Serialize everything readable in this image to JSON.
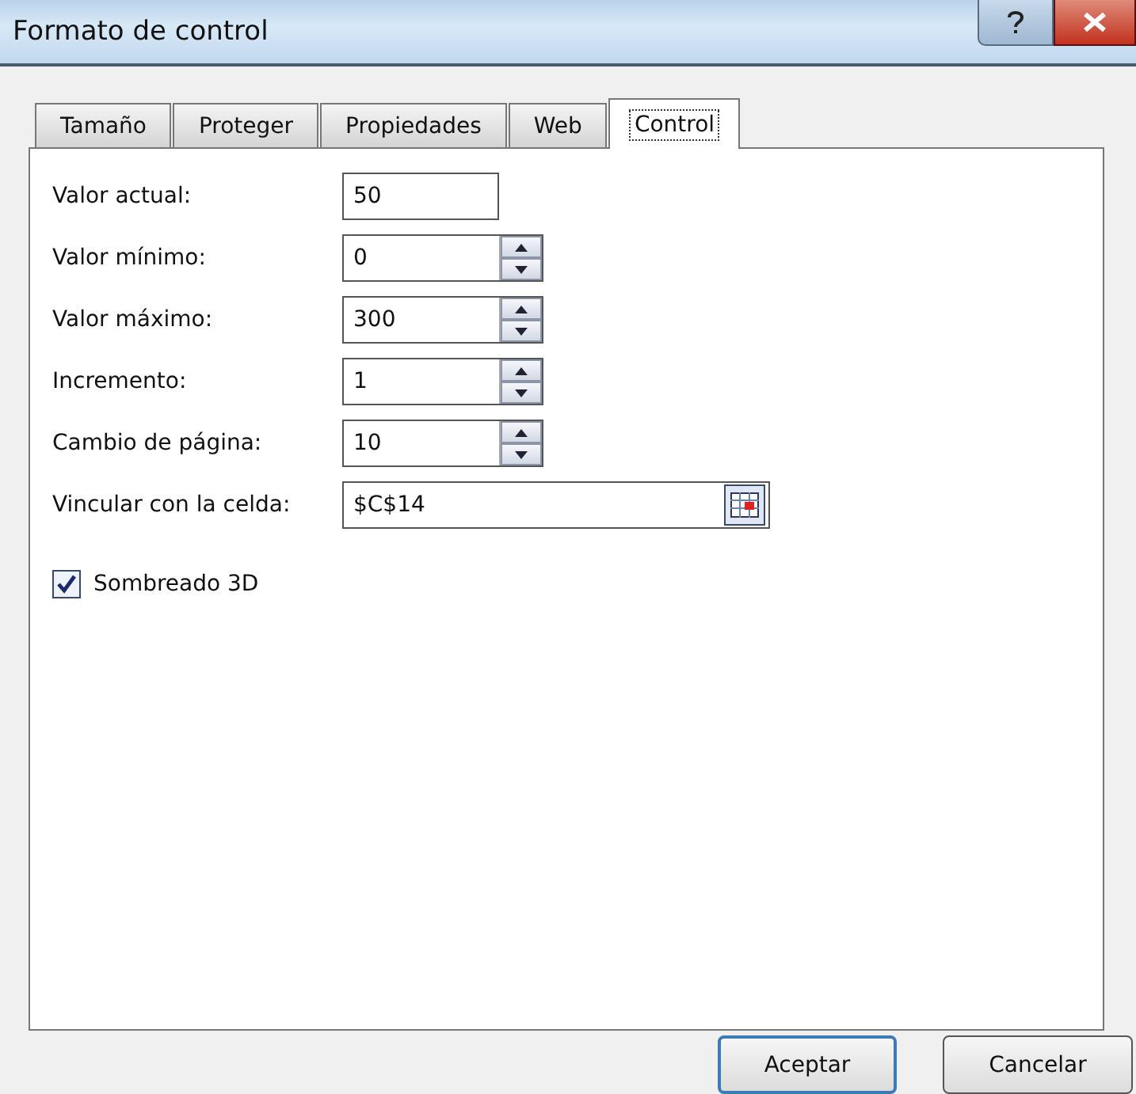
{
  "window": {
    "title": "Formato de control"
  },
  "tabs": [
    {
      "label": "Tamaño",
      "selected": false
    },
    {
      "label": "Proteger",
      "selected": false
    },
    {
      "label": "Propiedades",
      "selected": false
    },
    {
      "label": "Web",
      "selected": false
    },
    {
      "label": "Control",
      "selected": true
    }
  ],
  "fields": [
    {
      "label": "Valor actual:",
      "value": "50",
      "kind": "text"
    },
    {
      "label": "Valor mínimo:",
      "value": "0",
      "kind": "spinner"
    },
    {
      "label": "Valor máximo:",
      "value": "300",
      "kind": "spinner"
    },
    {
      "label": "Incremento:",
      "value": "1",
      "kind": "spinner"
    },
    {
      "label": "Cambio de página:",
      "value": "10",
      "kind": "spinner"
    },
    {
      "label": "Vincular con la celda:",
      "value": "$C$14",
      "kind": "reference"
    }
  ],
  "shading": {
    "label": "Sombreado 3D",
    "checked": true
  },
  "buttons": [
    {
      "label": "Aceptar",
      "kind": "default"
    },
    {
      "label": "Cancelar",
      "kind": "normal"
    }
  ]
}
